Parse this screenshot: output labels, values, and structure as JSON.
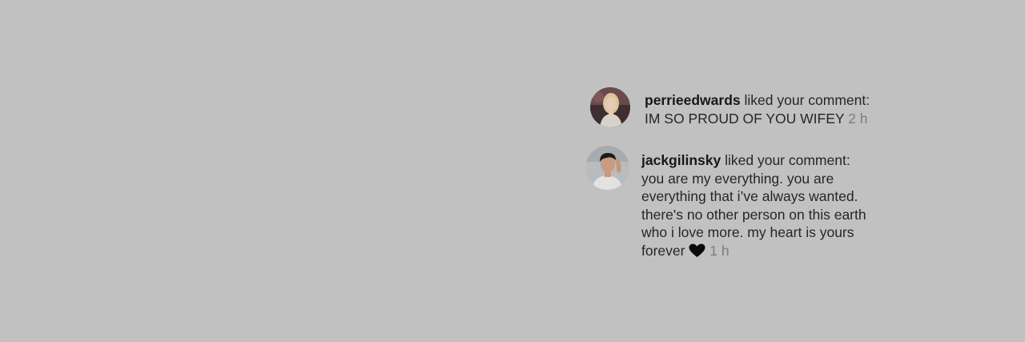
{
  "notifications": [
    {
      "username": "perrieedwards",
      "action": "liked your comment:",
      "comment": "IM SO PROUD OF YOU WIFEY",
      "time": "2 h",
      "avatar_icon": "profile-photo-blonde-woman"
    },
    {
      "username": "jackgilinsky",
      "action": "liked your comment:",
      "comment": "you are my everything. you are everything that i’ve always wanted. there's no other person on this earth who i love more. my heart is yours forever",
      "emoji": "black-heart-icon",
      "time": "1 h",
      "avatar_icon": "profile-photo-dark-haired-man"
    }
  ],
  "colors": {
    "background": "#c1c1c1",
    "text": "#262626",
    "timestamp": "#7e7e7e"
  }
}
